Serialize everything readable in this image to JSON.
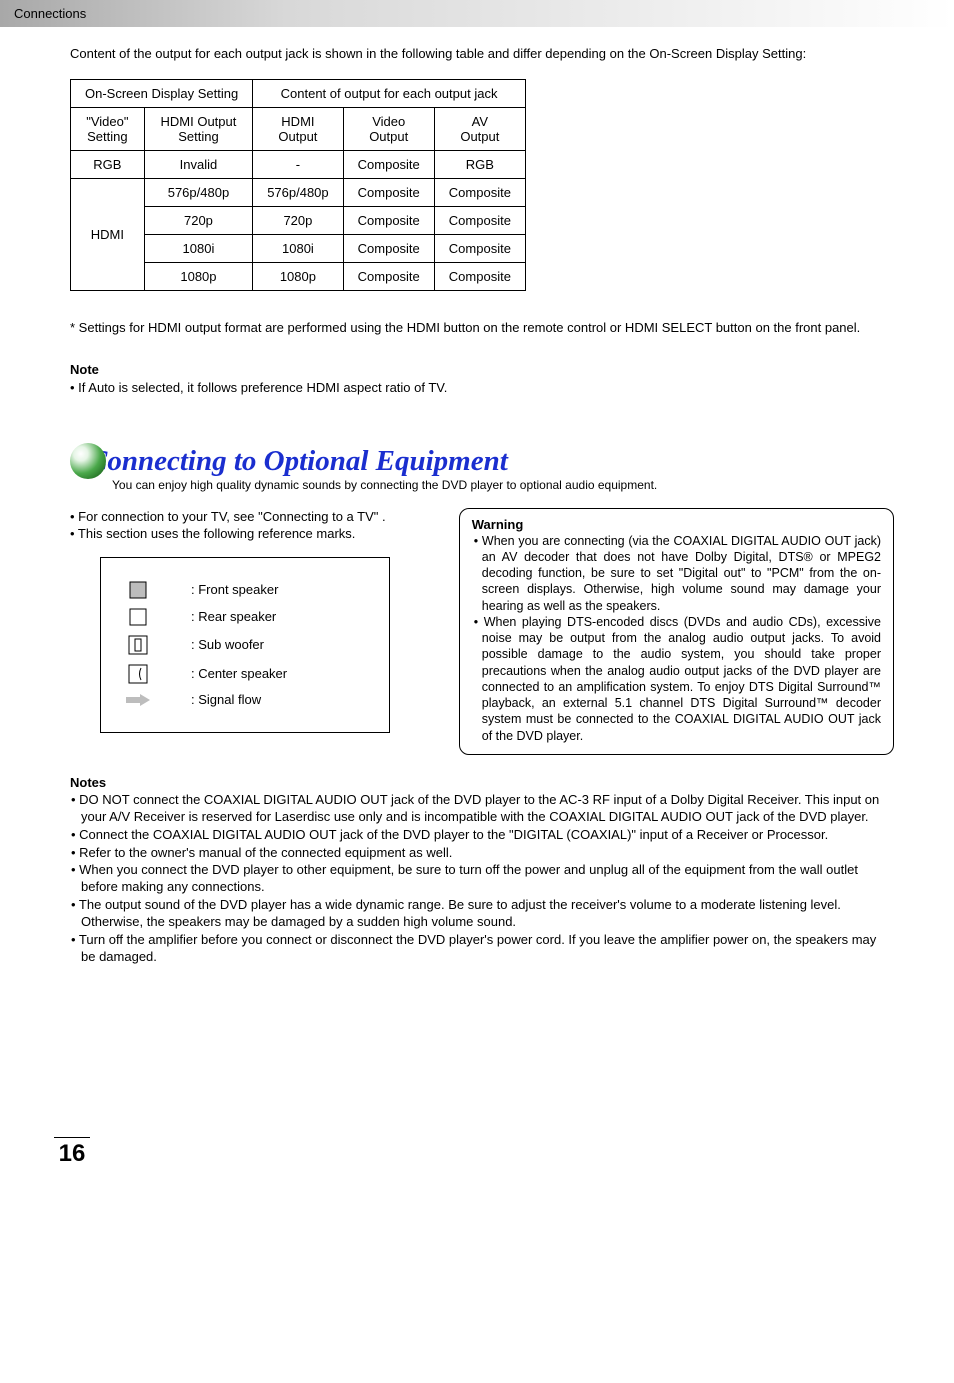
{
  "sectionName": "Connections",
  "introText": "Content of the output for each output jack is shown in the following table and differ depending on the On-Screen Display Setting:",
  "table": {
    "h1a": "On-Screen Display Setting",
    "h1b": "Content of output for each output jack",
    "h2": {
      "c1": "\"Video\"\nSetting",
      "c2": "HDMI Output\nSetting",
      "c3": "HDMI\nOutput",
      "c4": "Video\nOutput",
      "c5": "AV\nOutput"
    },
    "rows": [
      {
        "c1": "RGB",
        "c2": "Invalid",
        "c3": "-",
        "c4": "Composite",
        "c5": "RGB"
      },
      {
        "c1": "HDMI",
        "c2": "576p/480p",
        "c3": "576p/480p",
        "c4": "Composite",
        "c5": "Composite"
      },
      {
        "c1": "",
        "c2": "720p",
        "c3": "720p",
        "c4": "Composite",
        "c5": "Composite"
      },
      {
        "c1": "",
        "c2": "1080i",
        "c3": "1080i",
        "c4": "Composite",
        "c5": "Composite"
      },
      {
        "c1": "",
        "c2": "1080p",
        "c3": "1080p",
        "c4": "Composite",
        "c5": "Composite"
      }
    ]
  },
  "footnote": "* Settings for HDMI output format are performed using the HDMI button on the remote control or HDMI SELECT button on the front panel.",
  "noteTitle": "Note",
  "noteBody": "• If Auto is selected, it follows preference HDMI aspect ratio of TV.",
  "headingText": "Connecting to Optional Equipment",
  "headingSub": "You can enjoy high quality dynamic sounds by connecting the DVD player to optional audio equipment.",
  "leftBullets": [
    "•  For connection to your TV, see \"Connecting to a TV\" .",
    "•  This section uses the following reference marks."
  ],
  "legend": {
    "front": ": Front speaker",
    "rear": ": Rear speaker",
    "sub": ": Sub woofer",
    "center": ": Center speaker",
    "signal": ": Signal flow"
  },
  "warningTitle": "Warning",
  "warningItems": [
    "• When you are connecting (via the COAXIAL DIGITAL AUDIO OUT jack) an AV decoder that does not have Dolby Digital, DTS® or MPEG2 decoding function, be sure to set \"Digital out\" to \"PCM\" from the on-screen displays. Otherwise, high volume sound may damage your hearing as well as the speakers.",
    "• When playing DTS-encoded discs (DVDs and audio CDs), excessive noise may be output from the analog audio output jacks. To avoid possible damage to the audio system, you should take proper precautions when the analog audio output jacks of the DVD player are connected to an amplification system.  To enjoy DTS Digital Surround™ playback, an external 5.1 channel DTS Digital Surround™ decoder system must be connected to the COAXIAL DIGITAL AUDIO OUT jack of the DVD player."
  ],
  "notesTitle": "Notes",
  "notes": [
    "• DO NOT connect the COAXIAL DIGITAL AUDIO OUT jack of the DVD player to the AC-3 RF input of a Dolby Digital Receiver.  This input on your A/V Receiver is reserved for Laserdisc use only and is incompatible with the COAXIAL DIGITAL AUDIO OUT jack of the DVD player.",
    "• Connect the COAXIAL DIGITAL AUDIO OUT jack of the DVD player to the \"DIGITAL (COAXIAL)\" input of a Receiver or Processor.",
    "• Refer to the owner's manual of the connected equipment as well.",
    "• When you connect the DVD player to other equipment, be sure to turn off the power and unplug all of the equipment from the wall outlet before making any connections.",
    "• The output sound of the DVD player has a wide dynamic range. Be sure to adjust the receiver's volume to a moderate listening level. Otherwise, the speakers may be damaged by a sudden high volume sound.",
    "• Turn off the amplifier before you connect or disconnect the DVD player's power cord. If you leave the amplifier power on, the speakers may be damaged."
  ],
  "pageNumber": "16"
}
